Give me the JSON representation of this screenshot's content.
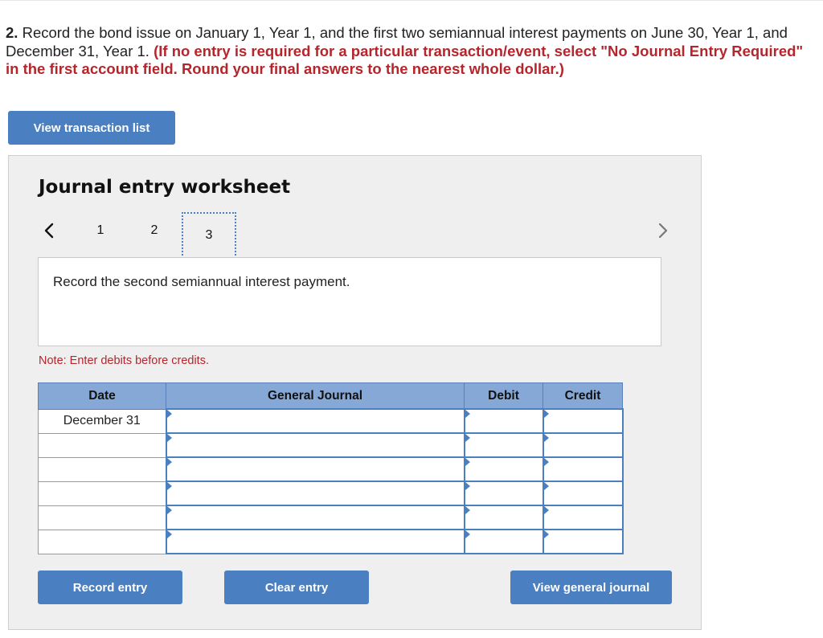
{
  "question": {
    "number": "2.",
    "text": "Record the bond issue on January 1, Year 1, and the first two semiannual interest payments on June 30, Year 1, and December 31, Year 1.",
    "instruction": "(If no entry is required for a particular transaction/event, select \"No Journal Entry Required\" in the first account field. Round your final answers to the nearest whole dollar.)"
  },
  "buttons": {
    "view_transaction_list": "View transaction list",
    "record_entry": "Record entry",
    "clear_entry": "Clear entry",
    "view_general_journal": "View general journal"
  },
  "worksheet": {
    "title": "Journal entry worksheet",
    "steps": [
      "1",
      "2",
      "3"
    ],
    "active_step": "3",
    "description": "Record the second semiannual interest payment.",
    "note": "Note: Enter debits before credits."
  },
  "table": {
    "headers": [
      "Date",
      "General Journal",
      "Debit",
      "Credit"
    ],
    "rows": [
      {
        "date": "December 31",
        "account": "",
        "debit": "",
        "credit": ""
      },
      {
        "date": "",
        "account": "",
        "debit": "",
        "credit": ""
      },
      {
        "date": "",
        "account": "",
        "debit": "",
        "credit": ""
      },
      {
        "date": "",
        "account": "",
        "debit": "",
        "credit": ""
      },
      {
        "date": "",
        "account": "",
        "debit": "",
        "credit": ""
      },
      {
        "date": "",
        "account": "",
        "debit": "",
        "credit": ""
      }
    ]
  },
  "colors": {
    "accent": "#4a7fc1",
    "header_bg": "#86a8d6",
    "instruction_red": "#b4262c",
    "panel_bg": "#efefef"
  },
  "icons": {
    "prev": "chevron-left-icon",
    "next": "chevron-right-icon"
  }
}
